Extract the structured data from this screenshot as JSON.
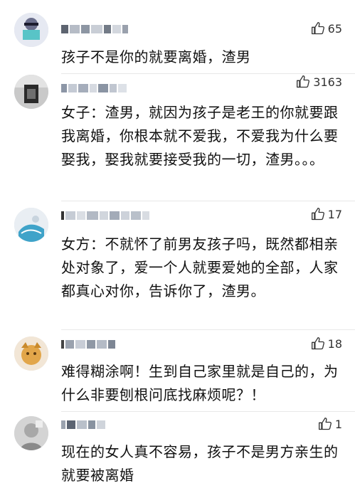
{
  "comments": [
    {
      "likes": "65",
      "text": "孩子不是你的就要离婚，渣男"
    },
    {
      "likes": "3163",
      "text": "女子：渣男，就因为孩子是老王的你就要跟我离婚，你根本就不爱我，不爱我为什么要娶我，娶我就要接受我的一切，渣男。。。"
    },
    {
      "likes": "17",
      "text": "女方：不就怀了前男友孩子吗，既然都相亲处对象了，爱一个人就要爱她的全部，人家都真心对你，告诉你了，渣男。"
    },
    {
      "likes": "18",
      "text": "难得糊涂啊！生到自己家里就是自己的，为什么非要刨根问底找麻烦呢？！"
    },
    {
      "likes": "1",
      "text": "现在的女人真不容易，孩子不是男方亲生的就要被离婚"
    }
  ],
  "icons": {
    "like": "thumbs-up-icon",
    "avatar": "avatar"
  },
  "colors": {
    "text": "#111111",
    "like_text": "#333333",
    "divider": "#e8e8e8"
  }
}
